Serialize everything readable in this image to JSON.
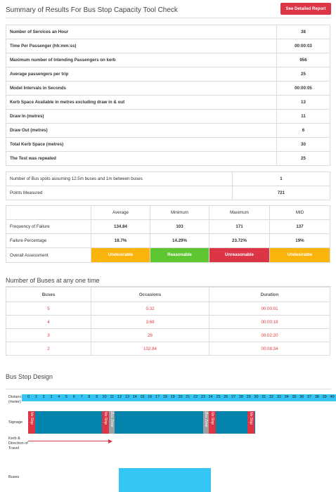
{
  "header": {
    "title": "Summary of Results For Bus Stop Capacity Tool Check",
    "detail_button": "See Detailed Report"
  },
  "summary": [
    {
      "label": "Number of Services an Hour",
      "value": "38"
    },
    {
      "label": "Time Per Passenger (hh:mm:ss)",
      "value": "00:00:03"
    },
    {
      "label": "Maximum number of Intending Passengers on kerb",
      "value": "956"
    },
    {
      "label": "Average passengers per trip",
      "value": "25"
    },
    {
      "label": "Model Intervals in Seconds",
      "value": "00:00:05"
    },
    {
      "label": "Kerb Space Available in metres excluding draw in & out",
      "value": "13"
    },
    {
      "label": "Draw In (metres)",
      "value": "11"
    },
    {
      "label": "Draw Out (metres)",
      "value": "6"
    },
    {
      "label": "Total Kerb Space (metres)",
      "value": "30"
    },
    {
      "label": "The Test was repeated",
      "value": "25"
    }
  ],
  "spots": [
    {
      "label": "Number of Bus spots assuming 12.5m buses and 1m between buses",
      "value": "1"
    },
    {
      "label": "Points Measured",
      "value": "721"
    }
  ],
  "failure": {
    "headers": [
      "",
      "Average",
      "Minimum",
      "Maximum",
      "MID"
    ],
    "rows": [
      {
        "label": "Frequency of Failure",
        "values": [
          "134.84",
          "103",
          "171",
          "137"
        ]
      },
      {
        "label": "Failure Percentage",
        "values": [
          "18.7%",
          "14.29%",
          "23.72%",
          "19%"
        ]
      }
    ],
    "assessment": {
      "label": "Overall Assessment",
      "values": [
        "Undesirable",
        "Reasonable",
        "Unreasonable",
        "Undesirable"
      ],
      "colors": [
        "#fbb40b",
        "#5ec630",
        "#dc3545",
        "#fbb40b"
      ]
    }
  },
  "buses_section": {
    "title": "Number of Buses at any one time",
    "headers": [
      "Buses",
      "Occasions",
      "Duration"
    ],
    "rows": [
      [
        "5",
        "0.32",
        "00:00:01"
      ],
      [
        "4",
        "3.68",
        "00:00:18"
      ],
      [
        "3",
        "28",
        "00:02:20"
      ],
      [
        "2",
        "102.84",
        "00:08:34"
      ]
    ]
  },
  "design": {
    "title": "Bus Stop Design",
    "distance_label": "Distance (meter)",
    "signage_label": "Signage",
    "kerb_label": "Kerb & Direction of Travel",
    "buses_label": "Buses",
    "ticks": [
      "0",
      "1",
      "2",
      "3",
      "4",
      "5",
      "6",
      "7",
      "8",
      "9",
      "10",
      "11",
      "12",
      "13",
      "14",
      "15",
      "16",
      "17",
      "18",
      "19",
      "20",
      "21",
      "22",
      "23",
      "24",
      "25",
      "26",
      "27",
      "28",
      "29",
      "30",
      "31",
      "32",
      "33",
      "34",
      "35",
      "36",
      "37",
      "38",
      "39",
      "40",
      "41"
    ],
    "no_stop_label": "No Stop",
    "bus_zone_label": "Bus Zone"
  }
}
